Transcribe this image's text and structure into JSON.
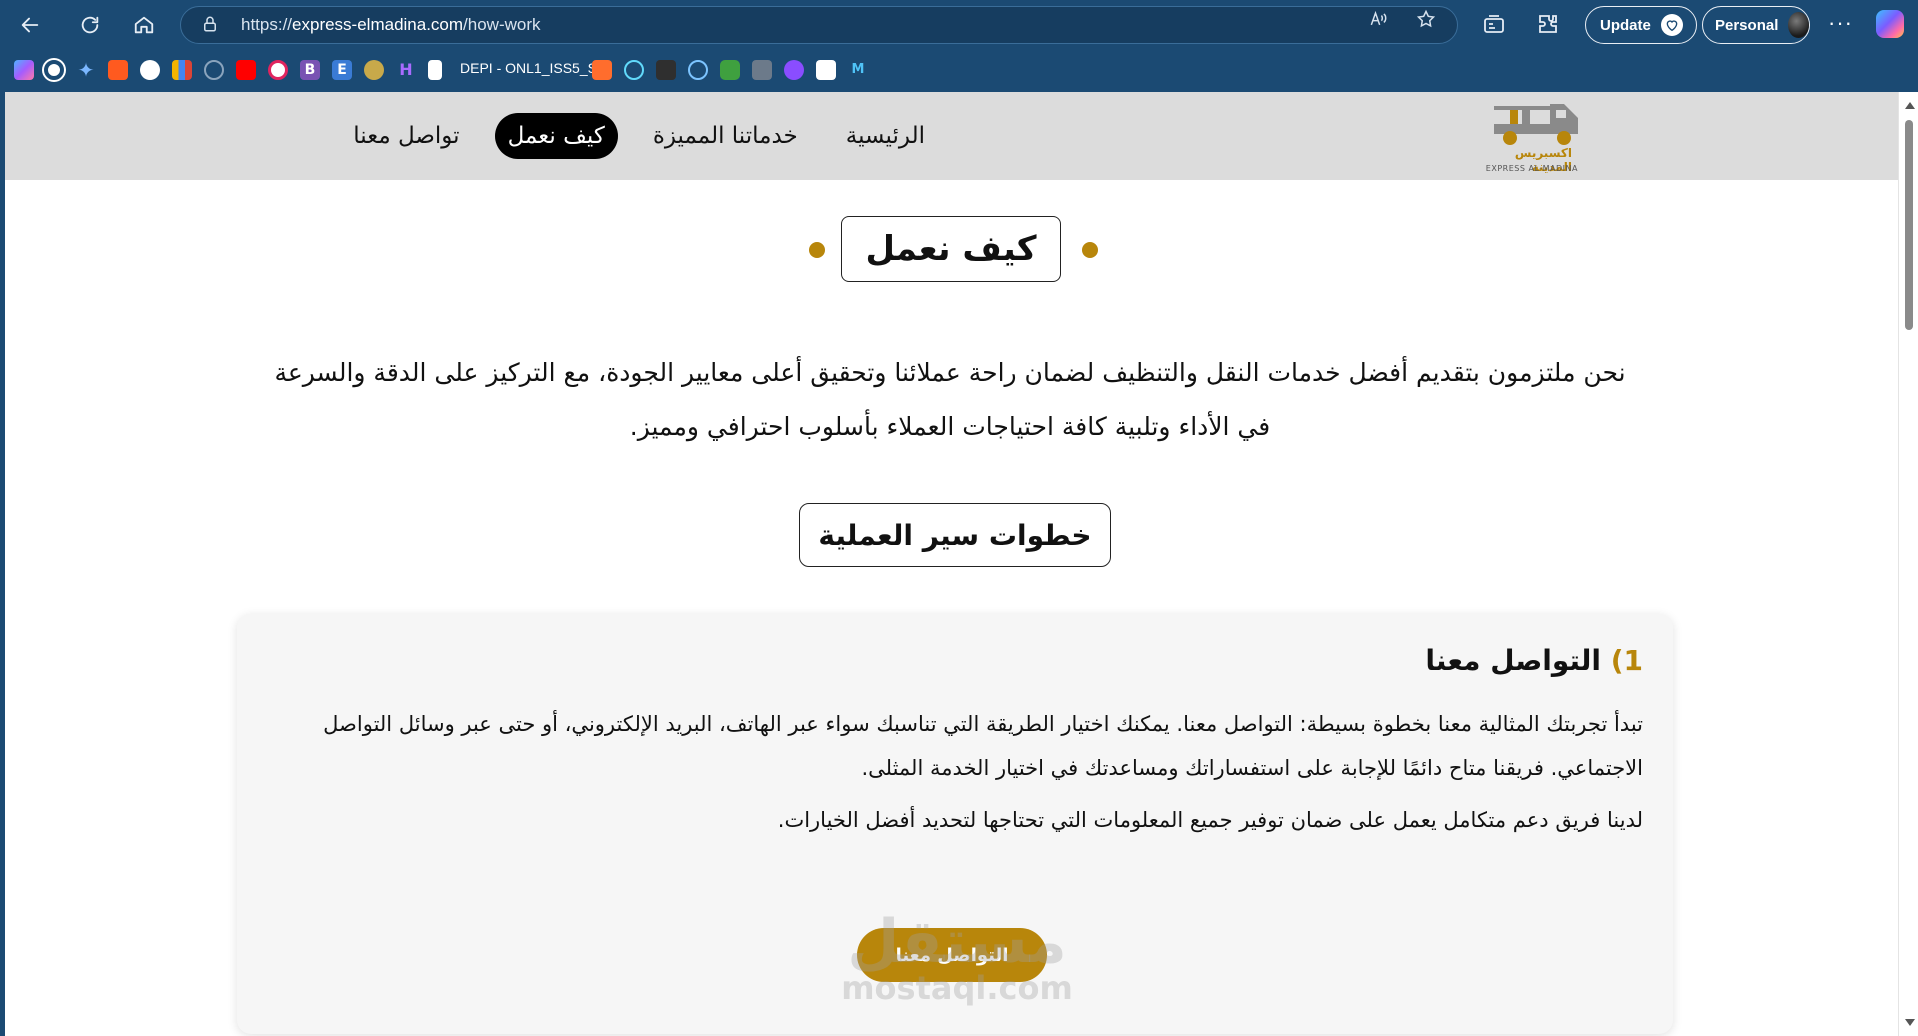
{
  "browser": {
    "url_prefix": "https://",
    "url_host": "express-elmadina.com",
    "url_path": "/how-work",
    "update_label": "Update",
    "profile_label": "Personal",
    "more_label": "···",
    "bookmark_text": "DEPI - ONL1_ISS5_S..."
  },
  "site": {
    "logo_text_ar": "اكسبريس المدينة",
    "logo_text_en": "EXPRESS AL-MADINA",
    "nav": [
      {
        "label": "الرئيسية"
      },
      {
        "label": "خدماتنا المميزة"
      },
      {
        "label": "كيف نعمل"
      },
      {
        "label": "تواصل معنا"
      }
    ],
    "page_title": "كيف نعمل",
    "intro": "نحن ملتزمون بتقديم أفضل خدمات النقل والتنظيف لضمان راحة عملائنا وتحقيق أعلى معايير الجودة، مع التركيز على الدقة والسرعة في الأداء وتلبية كافة احتياجات العملاء بأسلوب احترافي ومميز.",
    "steps_label": "خطوات سير العملية",
    "step1": {
      "number": "1)",
      "title": "التواصل معنا",
      "paragraph1": "تبدأ تجربتك المثالية معنا بخطوة بسيطة: التواصل معنا. يمكنك اختيار الطريقة التي تناسبك سواء عبر الهاتف، البريد الإلكتروني، أو حتى عبر وسائل التواصل الاجتماعي. فريقنا متاح دائمًا للإجابة على استفساراتك ومساعدتك في اختيار الخدمة المثلى.",
      "paragraph2": "لدينا فريق دعم متكامل يعمل على ضمان توفير جميع المعلومات التي تحتاجها لتحديد أفضل الخيارات.",
      "button_label": "التواصل معنا"
    },
    "watermark_ar": "مستقل",
    "watermark_en": "mostaql.com"
  },
  "colors": {
    "chrome": "#1b4a73",
    "accent_gold": "#b8860b",
    "header_bg": "#dcdcdc"
  }
}
